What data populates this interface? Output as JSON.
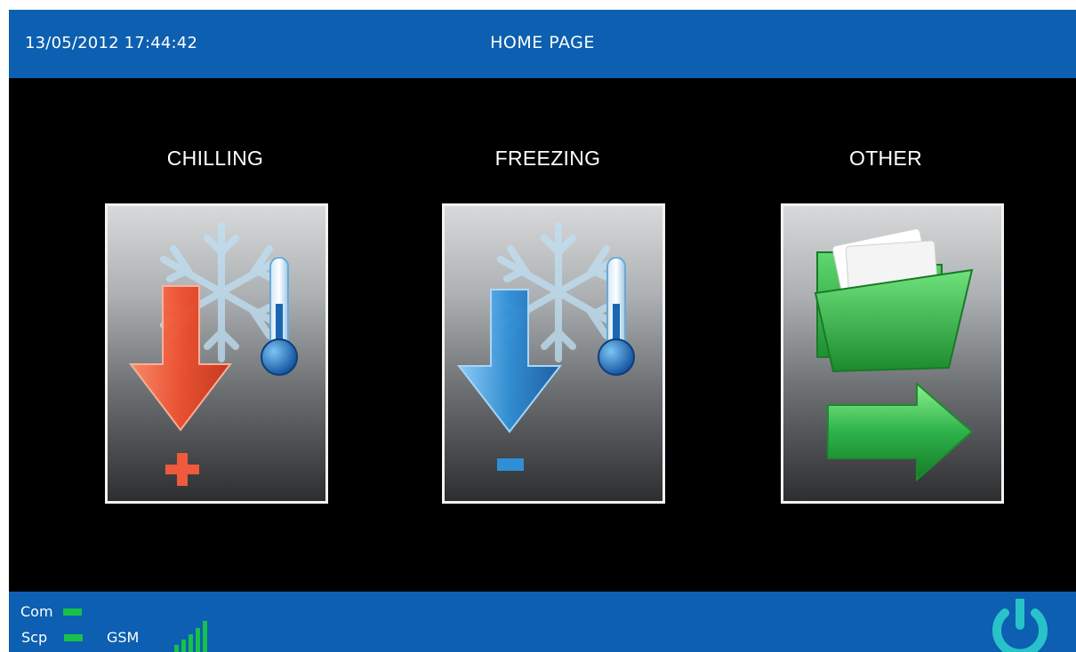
{
  "header": {
    "datetime": "13/05/2012 17:44:42",
    "title": "HOME PAGE"
  },
  "tiles": [
    {
      "label": "CHILLING",
      "icon": "chilling-icon",
      "accent": "#f05a3c"
    },
    {
      "label": "FREEZING",
      "icon": "freezing-icon",
      "accent": "#2f8fd6"
    },
    {
      "label": "OTHER",
      "icon": "folder-arrow-icon",
      "accent": "#2eb34a"
    }
  ],
  "status": {
    "com_label": "Com",
    "scp_label": "Scp",
    "gsm_label": "GSM",
    "indicator_color": "#19c049",
    "gsm_signal_bars": 5
  },
  "colors": {
    "bar_background": "#0c5fb1",
    "screen_background": "#000000"
  },
  "power_icon": "power-icon"
}
